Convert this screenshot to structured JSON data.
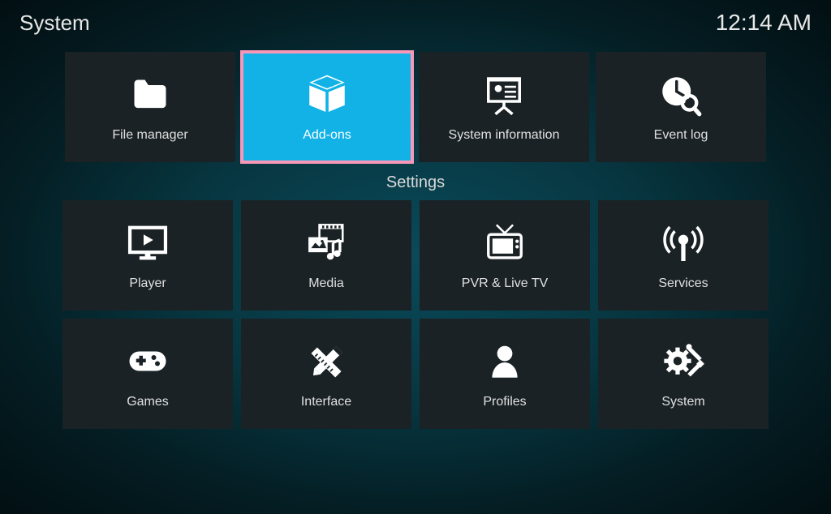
{
  "header": {
    "title": "System",
    "clock": "12:14 AM"
  },
  "topRow": [
    {
      "id": "file-manager",
      "label": "File manager",
      "icon": "folder",
      "selected": false
    },
    {
      "id": "add-ons",
      "label": "Add-ons",
      "icon": "box",
      "selected": true
    },
    {
      "id": "system-information",
      "label": "System information",
      "icon": "presentation",
      "selected": false
    },
    {
      "id": "event-log",
      "label": "Event log",
      "icon": "clock-search",
      "selected": false
    }
  ],
  "sectionLabel": "Settings",
  "settingsGrid": [
    {
      "id": "player",
      "label": "Player",
      "icon": "play-monitor"
    },
    {
      "id": "media",
      "label": "Media",
      "icon": "media"
    },
    {
      "id": "pvr",
      "label": "PVR & Live TV",
      "icon": "tv"
    },
    {
      "id": "services",
      "label": "Services",
      "icon": "broadcast"
    },
    {
      "id": "games",
      "label": "Games",
      "icon": "gamepad"
    },
    {
      "id": "interface",
      "label": "Interface",
      "icon": "pencil-ruler"
    },
    {
      "id": "profiles",
      "label": "Profiles",
      "icon": "profile"
    },
    {
      "id": "system",
      "label": "System",
      "icon": "gear-tools"
    }
  ]
}
